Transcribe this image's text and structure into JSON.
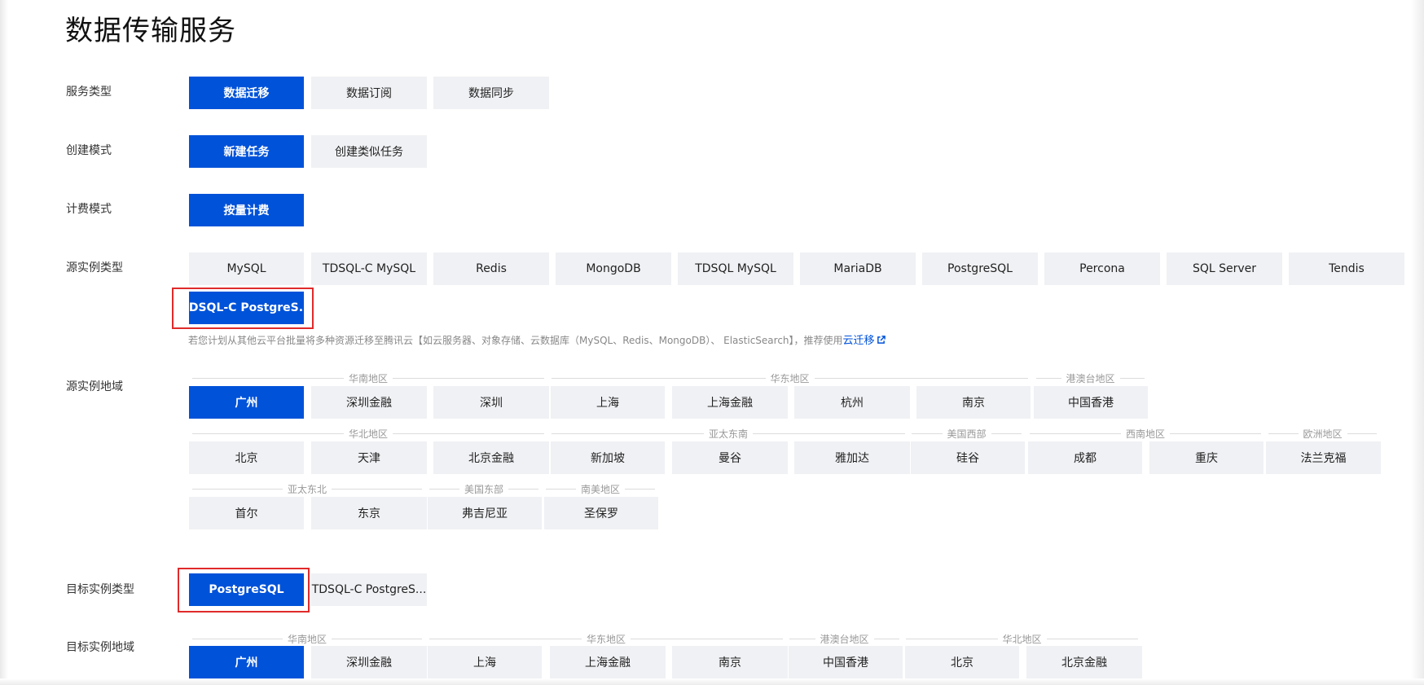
{
  "title": "数据传输服务",
  "labels": {
    "service_type": "服务类型",
    "create_mode": "创建模式",
    "billing_mode": "计费模式",
    "source_type": "源实例类型",
    "source_region": "源实例地域",
    "target_type": "目标实例类型",
    "target_region": "目标实例地域"
  },
  "service_type": {
    "options": [
      "数据迁移",
      "数据订阅",
      "数据同步"
    ],
    "selected": "数据迁移"
  },
  "create_mode": {
    "options": [
      "新建任务",
      "创建类似任务"
    ],
    "selected": "新建任务"
  },
  "billing_mode": {
    "options": [
      "按量计费"
    ],
    "selected": "按量计费"
  },
  "source_type": {
    "options": [
      "MySQL",
      "TDSQL-C MySQL",
      "Redis",
      "MongoDB",
      "TDSQL MySQL",
      "MariaDB",
      "PostgreSQL",
      "Percona",
      "SQL Server",
      "Tendis",
      "TDSQL-C PostgreS..."
    ],
    "selected": "TDSQL-C PostgreS..."
  },
  "hint": {
    "text": "若您计划从其他云平台批量将多种资源迁移至腾讯云【如云服务器、对象存储、云数据库（MySQL、Redis、MongoDB）、 ElasticSearch】，推荐使用",
    "link": "云迁移"
  },
  "source_region": {
    "groups": [
      "华南地区",
      "华东地区",
      "港澳台地区",
      "华北地区",
      "亚太东南",
      "美国西部",
      "西南地区",
      "欧洲地区",
      "亚太东北",
      "美国东部",
      "南美地区"
    ],
    "options": [
      "广州",
      "深圳金融",
      "深圳",
      "上海",
      "上海金融",
      "杭州",
      "南京",
      "中国香港",
      "北京",
      "天津",
      "北京金融",
      "新加坡",
      "曼谷",
      "雅加达",
      "硅谷",
      "成都",
      "重庆",
      "法兰克福",
      "首尔",
      "东京",
      "弗吉尼亚",
      "圣保罗"
    ],
    "selected": "广州"
  },
  "target_type": {
    "options": [
      "PostgreSQL",
      "TDSQL-C PostgreS..."
    ],
    "selected": "PostgreSQL"
  },
  "target_region": {
    "groups": [
      "华南地区",
      "华东地区",
      "港澳台地区",
      "华北地区"
    ],
    "options": [
      "广州",
      "深圳金融",
      "上海",
      "上海金融",
      "南京",
      "中国香港",
      "北京",
      "北京金融"
    ],
    "selected": "广州"
  },
  "colors": {
    "primary": "#0052d9",
    "button_bg": "#f0f1f4",
    "highlight": "#e02a2a"
  },
  "icons": {
    "hint_link_icon": "external-link-icon"
  }
}
